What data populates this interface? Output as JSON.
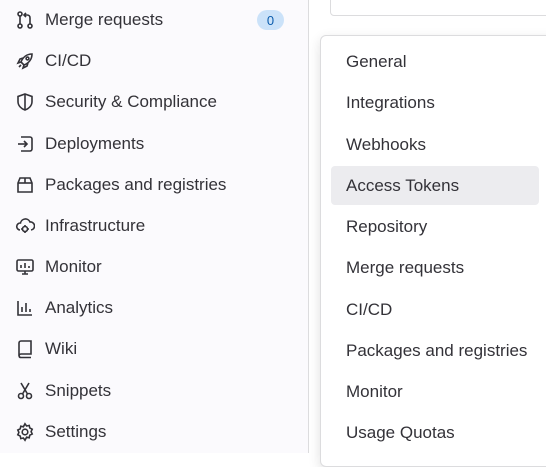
{
  "sidebar": {
    "items": [
      {
        "label": "Merge requests",
        "icon": "merge-request-icon",
        "badge": "0"
      },
      {
        "label": "CI/CD",
        "icon": "rocket-icon"
      },
      {
        "label": "Security & Compliance",
        "icon": "shield-icon"
      },
      {
        "label": "Deployments",
        "icon": "deployments-icon"
      },
      {
        "label": "Packages and registries",
        "icon": "package-icon"
      },
      {
        "label": "Infrastructure",
        "icon": "cloud-gear-icon"
      },
      {
        "label": "Monitor",
        "icon": "monitor-icon"
      },
      {
        "label": "Analytics",
        "icon": "analytics-icon"
      },
      {
        "label": "Wiki",
        "icon": "book-icon"
      },
      {
        "label": "Snippets",
        "icon": "scissors-icon"
      },
      {
        "label": "Settings",
        "icon": "gear-icon"
      }
    ]
  },
  "flyout": {
    "items": [
      {
        "label": "General"
      },
      {
        "label": "Integrations"
      },
      {
        "label": "Webhooks"
      },
      {
        "label": "Access Tokens",
        "active": true
      },
      {
        "label": "Repository"
      },
      {
        "label": "Merge requests"
      },
      {
        "label": "CI/CD"
      },
      {
        "label": "Packages and registries"
      },
      {
        "label": "Monitor"
      },
      {
        "label": "Usage Quotas"
      }
    ]
  },
  "colors": {
    "sidebar_bg": "#fbfafd",
    "text": "#333238",
    "badge_bg": "#cbe2f9",
    "badge_text": "#0b5cad",
    "active_item_bg": "#ececef"
  }
}
